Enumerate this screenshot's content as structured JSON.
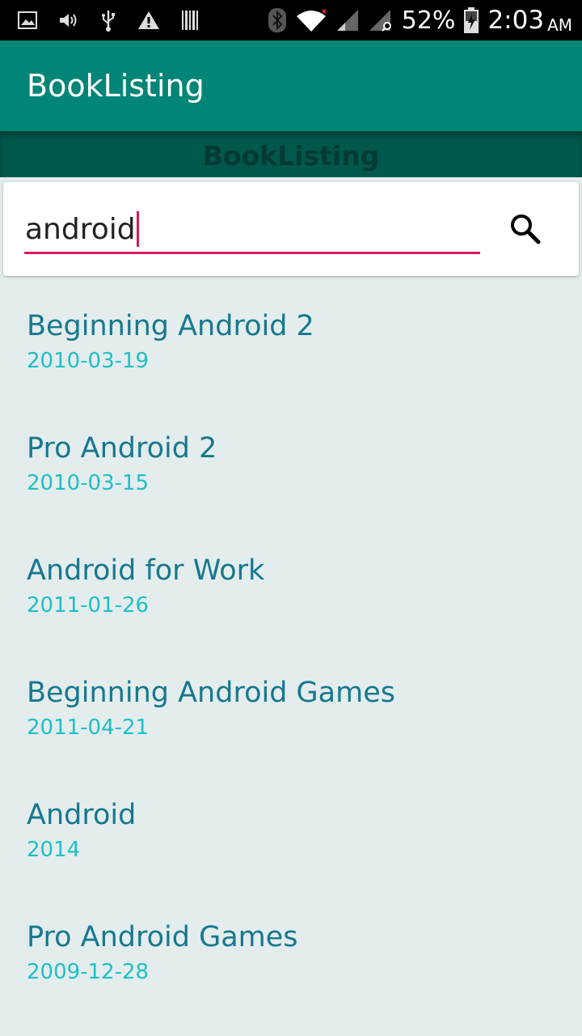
{
  "status_bar": {
    "icons": [
      "image-icon",
      "volume-icon",
      "usb-icon",
      "warning-icon",
      "barcode-icon",
      "bluetooth-icon",
      "wifi-icon",
      "signal-icon",
      "signal-search-icon",
      "battery-charging-icon"
    ],
    "battery_percent": "52%",
    "time": "2:03",
    "ampm": "AM"
  },
  "app_bar": {
    "title": "BookListing"
  },
  "sub_bar": {
    "title": "BookListing"
  },
  "search": {
    "value": "android",
    "button_icon": "search-icon",
    "accent_color": "#d81b60"
  },
  "books": [
    {
      "title": "Beginning Android 2",
      "date": "2010-03-19"
    },
    {
      "title": "Pro Android 2",
      "date": "2010-03-15"
    },
    {
      "title": "Android for Work",
      "date": "2011-01-26"
    },
    {
      "title": "Beginning Android Games",
      "date": "2011-04-21"
    },
    {
      "title": "Android",
      "date": "2014"
    },
    {
      "title": "Pro Android Games",
      "date": "2009-12-28"
    }
  ],
  "colors": {
    "primary": "#008577",
    "primary_dark": "#00574b",
    "title_text": "#17788f",
    "date_text": "#1fbfc6",
    "background": "#e4eded"
  }
}
